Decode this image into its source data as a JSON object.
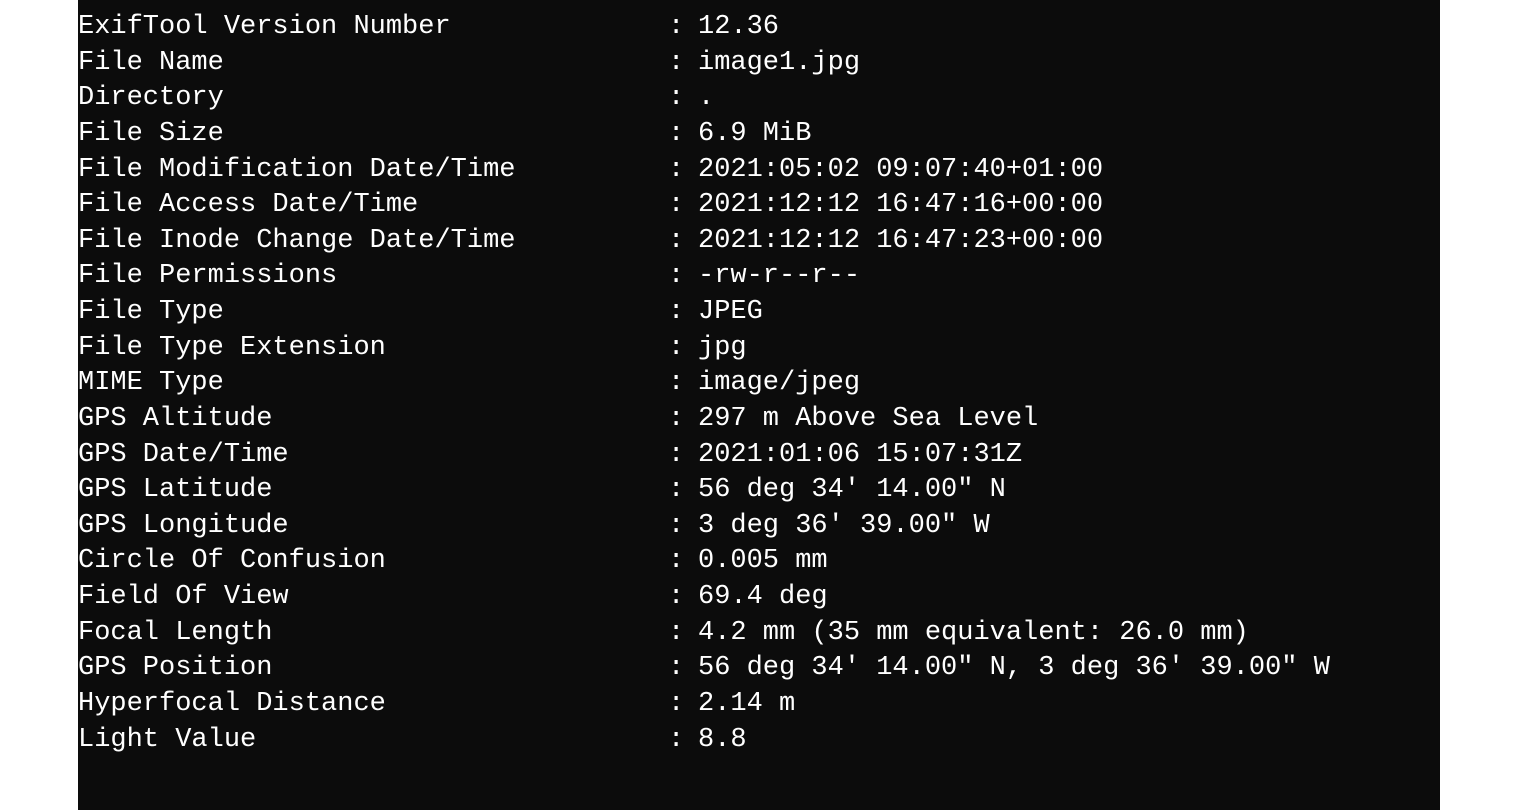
{
  "rows": [
    {
      "label": "ExifTool Version Number",
      "value": "12.36"
    },
    {
      "label": "File Name",
      "value": "image1.jpg"
    },
    {
      "label": "Directory",
      "value": "."
    },
    {
      "label": "File Size",
      "value": "6.9 MiB"
    },
    {
      "label": "File Modification Date/Time",
      "value": "2021:05:02 09:07:40+01:00"
    },
    {
      "label": "File Access Date/Time",
      "value": "2021:12:12 16:47:16+00:00"
    },
    {
      "label": "File Inode Change Date/Time",
      "value": "2021:12:12 16:47:23+00:00"
    },
    {
      "label": "File Permissions",
      "value": "-rw-r--r--"
    },
    {
      "label": "File Type",
      "value": "JPEG"
    },
    {
      "label": "File Type Extension",
      "value": "jpg"
    },
    {
      "label": "MIME Type",
      "value": "image/jpeg"
    },
    {
      "label": "GPS Altitude",
      "value": "297 m Above Sea Level"
    },
    {
      "label": "GPS Date/Time",
      "value": "2021:01:06 15:07:31Z"
    },
    {
      "label": "GPS Latitude",
      "value": "56 deg 34' 14.00\" N"
    },
    {
      "label": "GPS Longitude",
      "value": "3 deg 36' 39.00\" W"
    },
    {
      "label": "Circle Of Confusion",
      "value": "0.005 mm"
    },
    {
      "label": "Field Of View",
      "value": "69.4 deg"
    },
    {
      "label": "Focal Length",
      "value": "4.2 mm (35 mm equivalent: 26.0 mm)"
    },
    {
      "label": "GPS Position",
      "value": "56 deg 34' 14.00\" N, 3 deg 36' 39.00\" W"
    },
    {
      "label": "Hyperfocal Distance",
      "value": "2.14 m"
    },
    {
      "label": "Light Value",
      "value": "8.8"
    }
  ],
  "separator": ": "
}
